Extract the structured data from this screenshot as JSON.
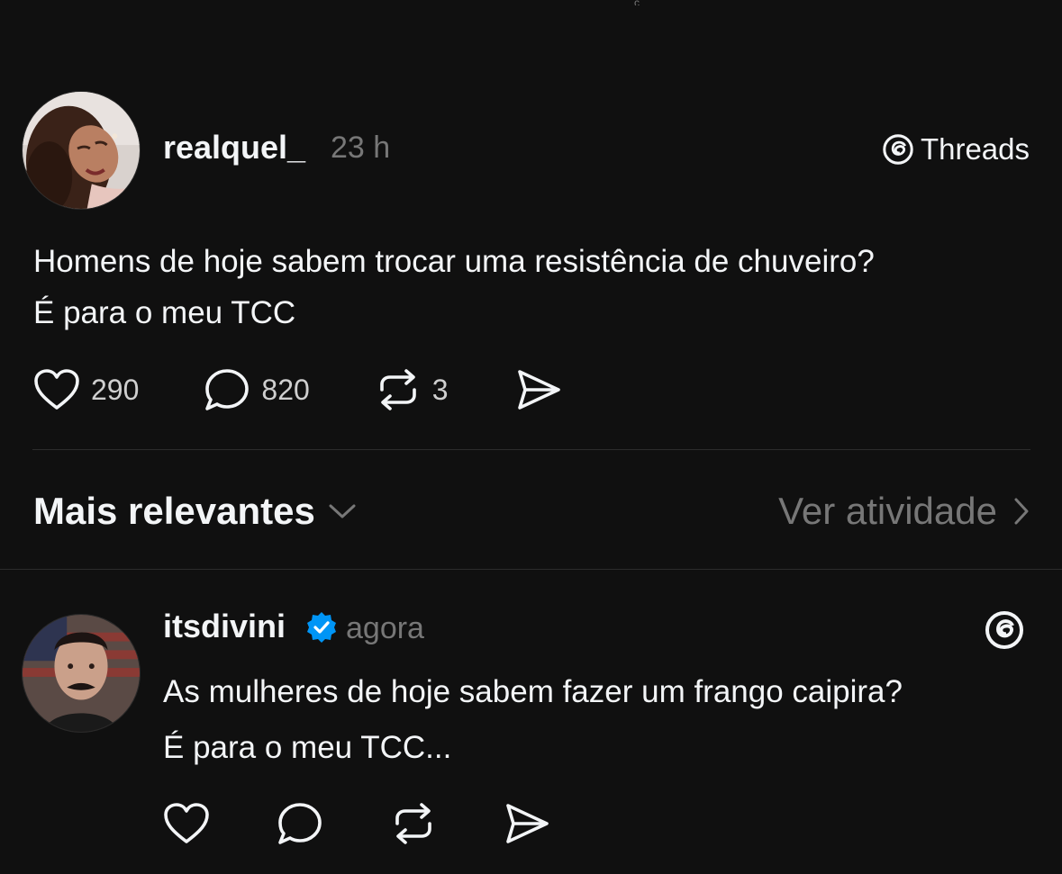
{
  "top_fragment": "ç",
  "post": {
    "username": "realquel_",
    "time": "23 h",
    "brand_label": "Threads",
    "text_line1": "Homens de hoje sabem trocar uma resistência de chuveiro?",
    "text_line2": "É para o meu TCC",
    "likes": "290",
    "comments": "820",
    "reposts": "3"
  },
  "sort": {
    "label": "Mais relevantes",
    "activity_label": "Ver atividade"
  },
  "reply": {
    "username": "itsdivini",
    "time": "agora",
    "verified": true,
    "text_line1": "As mulheres de hoje sabem fazer um frango caipira?",
    "text_line2": "É para o meu TCC..."
  },
  "icons": {
    "like": "heart-icon",
    "comment": "comment-bubble-icon",
    "repost": "repost-icon",
    "share": "send-icon",
    "brand": "threads-logo-icon",
    "verified": "verified-badge-icon",
    "sort": "chevron-down-icon",
    "activity": "chevron-right-icon"
  },
  "colors": {
    "background": "#101010",
    "text_primary": "#f3f5f7",
    "text_secondary": "#777777",
    "divider": "#2c2c2c",
    "verified_blue": "#0095f6"
  }
}
